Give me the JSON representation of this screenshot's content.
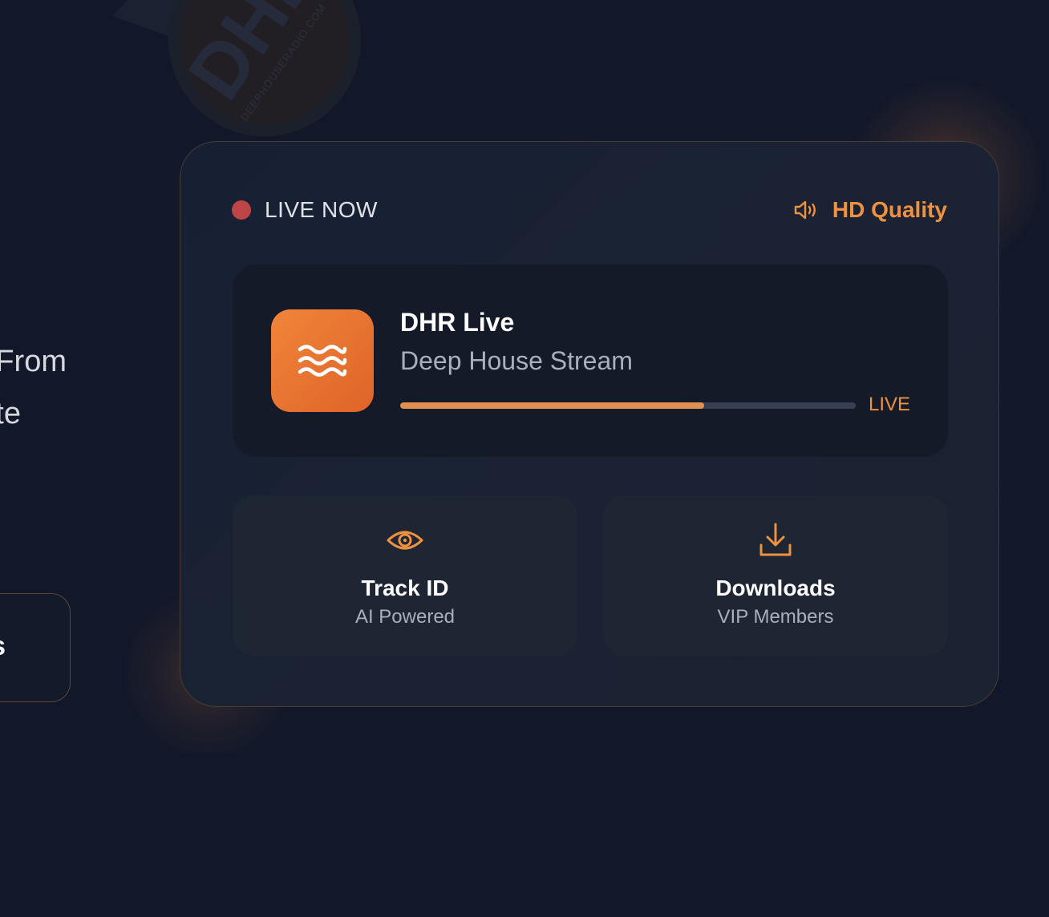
{
  "hero": {
    "line1": "From",
    "line2": "te",
    "cta_partial": "s"
  },
  "background_logo": {
    "text": "DHR",
    "subtext": "DEEPHOUSERADIO.COM"
  },
  "player": {
    "live_label": "LIVE NOW",
    "quality_label": "HD Quality",
    "station_name": "DHR Live",
    "station_desc": "Deep House Stream",
    "progress_fraction": 0.667,
    "live_tag": "LIVE"
  },
  "features": [
    {
      "title": "Track ID",
      "subtitle": "AI Powered",
      "icon": "eye-icon"
    },
    {
      "title": "Downloads",
      "subtitle": "VIP Members",
      "icon": "download-icon"
    }
  ],
  "colors": {
    "background": "#121829",
    "accent": "#f0913f",
    "live_dot": "#bd4545",
    "card": "#1a2233",
    "panel": "#141a28",
    "tile": "#1e2533",
    "progress_fill": "#e09050",
    "progress_track": "#374052"
  }
}
